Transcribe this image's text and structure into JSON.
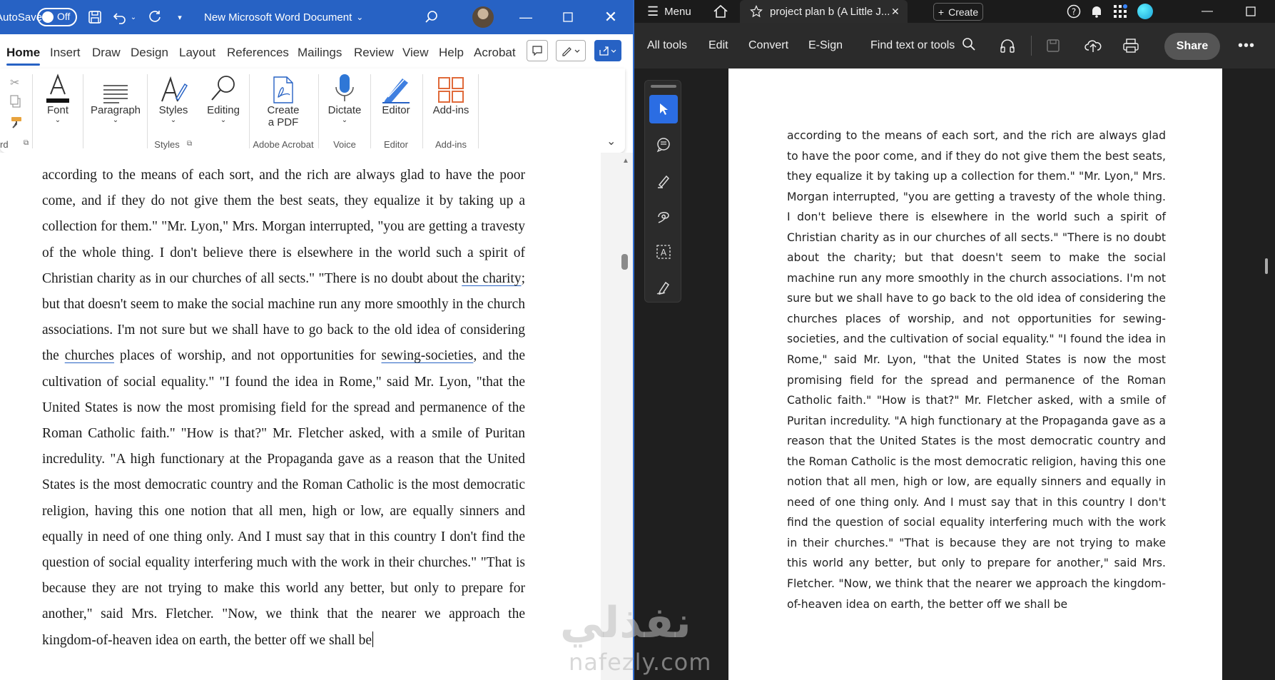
{
  "word": {
    "autosave_label": "AutoSave",
    "autosave_state": "Off",
    "doc_title": "New Microsoft Word Document",
    "tabs": [
      "Home",
      "Insert",
      "Draw",
      "Design",
      "Layout",
      "References",
      "Mailings",
      "Review",
      "View",
      "Help",
      "Acrobat"
    ],
    "active_tab": "Home",
    "ribbon": {
      "clipboard_label": "rd",
      "font_label": "Font",
      "paragraph_label": "Paragraph",
      "styles_btn": "Styles",
      "editing_btn": "Editing",
      "styles_group": "Styles",
      "create_pdf_line1": "Create",
      "create_pdf_line2": "a PDF",
      "adobe_group": "Adobe Acrobat",
      "dictate_btn": "Dictate",
      "voice_group": "Voice",
      "editor_btn": "Editor",
      "editor_group": "Editor",
      "addins_btn": "Add-ins",
      "addins_group": "Add-ins"
    },
    "doc": {
      "p1": "according to the means of each sort, and the rich are always glad to have the poor come, and if they do not give them the best seats, they equalize it by taking up a collection for them.\" \"Mr. Lyon,\" Mrs. Morgan interrupted, \"you are getting a travesty of the whole thing. I don't believe there is elsewhere in the world such a spirit of Christian charity as in our churches of all sects.\" \"There is no doubt about ",
      "u1": "the charity",
      "p2": "; but that doesn't seem to make the social machine run any more smoothly in the church associations. I'm not sure but we shall have to go back to the old idea of considering the ",
      "u2": "churches",
      "p3": " places of worship, and not opportunities for ",
      "u3": "sewing-societies",
      "p4": ", and the cultivation of social equality.\" \"I found the idea in Rome,\" said Mr. Lyon, \"that the United States is now the most promising field for the spread and permanence of the Roman Catholic faith.\" \"How is that?\" Mr. Fletcher asked, with a smile of Puritan incredulity. \"A high functionary at the Propaganda gave as a reason that the United States is the most democratic country and the Roman Catholic is the most democratic religion, having this one notion that all men, high or low, are equally sinners and equally in need of one thing only. And I must say that in this country I don't find the question of social equality interfering much with the work in their churches.\" \"That is because they are not trying to make this world any better, but only to prepare for another,\" said Mrs. Fletcher. \"Now, we think that the nearer we approach the kingdom-of-heaven idea on earth, the better off we shall be"
    }
  },
  "acrobat": {
    "menu_label": "Menu",
    "tab_title": "project plan b (A Little J...",
    "create_label": "Create",
    "toolbar": [
      "All tools",
      "Edit",
      "Convert",
      "E-Sign"
    ],
    "find_label": "Find text or tools",
    "share_label": "Share",
    "pdf_text": "according to the means of each sort, and the rich are always glad to have the poor come, and if they do not give them the best seats, they equalize it by taking up a collection for them.\" \"Mr. Lyon,\" Mrs. Morgan interrupted, \"you are getting a travesty of the whole thing. I don't believe there is elsewhere in the world such a spirit of Christian charity as in our churches of all sects.\" \"There is no doubt about the charity; but that doesn't seem to make the social machine run any more smoothly in the church associations. I'm not sure but we shall have to go back to the old idea of considering the churches places of worship, and not opportunities for sewing-societies, and the cultivation of social equality.\" \"I found the idea in Rome,\" said Mr. Lyon, \"that the United States is now the most promising field for the spread and permanence of the Roman Catholic faith.\" \"How is that?\" Mr. Fletcher asked, with a smile of Puritan incredulity. \"A high functionary at the Propaganda gave as a reason that the United States is the most democratic country and the Roman Catholic is the most democratic religion, having this one notion that all men, high or low, are equally sinners and equally in need of one thing only. And I must say that in this country I don't find the question of social equality interfering much with the work in their churches.\" \"That is because they are not trying to make this world any better, but only to prepare for another,\" said Mrs. Fletcher. \"Now, we think that the nearer we approach the kingdom-of-heaven idea on earth, the better off we shall be"
  },
  "watermark": {
    "arabic": "نفذلي",
    "latin": "nafezly.com"
  },
  "colors": {
    "word_blue": "#2762c4",
    "acrobat_dark": "#1f1f1f",
    "acrobat_accent": "#2b6de3"
  }
}
